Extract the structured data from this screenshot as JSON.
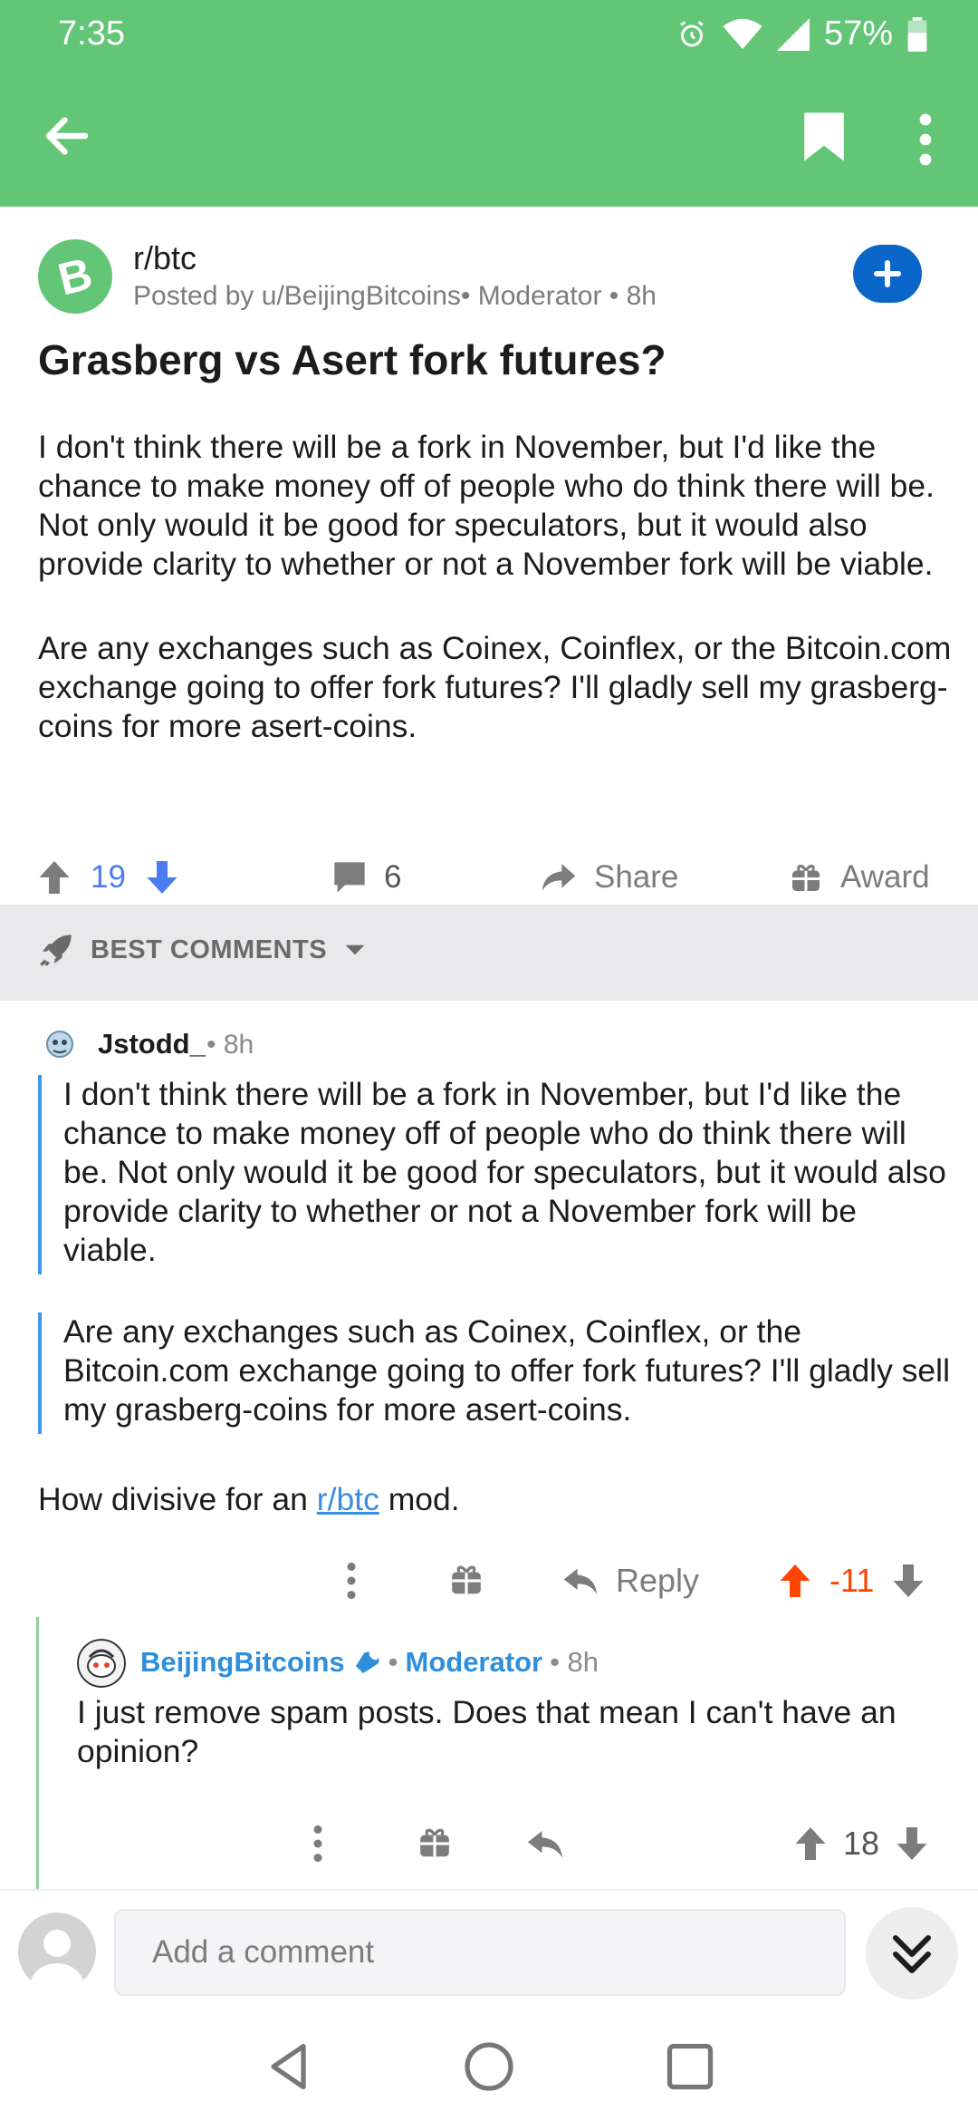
{
  "status_bar": {
    "time": "7:35",
    "battery": "57%"
  },
  "toolbar": {
    "back_icon": "arrow-left-icon",
    "bookmark_icon": "bookmark-icon",
    "more_icon": "more-vertical-icon"
  },
  "post": {
    "subreddit": "r/btc",
    "meta": "Posted by u/BeijingBitcoins• Moderator • 8h",
    "title": "Grasberg vs Asert fork futures?",
    "body": [
      "I don't think there will be a fork in November, but I'd like the chance to make money off of people who do think there will be. Not only would it be good for speculators, but it would also provide clarity to whether or not a November fork will be viable.",
      "Are any exchanges such as Coinex, Coinflex, or the Bitcoin.com exchange going to offer fork futures? I'll gladly sell my grasberg-coins for more asert-coins."
    ],
    "votes": "19",
    "comments": "6",
    "share_label": "Share",
    "award_label": "Award"
  },
  "sort": {
    "label": "BEST COMMENTS"
  },
  "comment": {
    "author": "Jstodd_",
    "time": "• 8h",
    "quote": [
      "I don't think there will be a fork in November, but I'd like the chance to make money off of people who do think there will be. Not only would it be good for speculators, but it would also provide clarity to whether or not a November fork will be viable.",
      "Are any exchanges such as Coinex, Coinflex, or the Bitcoin.com exchange going to offer fork futures? I'll gladly sell my grasberg-coins for more asert-coins."
    ],
    "text_before": "How divisive for an ",
    "link": "r/btc",
    "text_after": " mod.",
    "reply_label": "Reply",
    "score": "-11"
  },
  "reply": {
    "author": "BeijingBitcoins",
    "moderator": "Moderator",
    "time": "• 8h",
    "text": "I just remove spam posts. Does that mean I can't have an opinion?",
    "score": "18"
  },
  "comment_bar": {
    "placeholder": "Add a comment"
  },
  "colors": {
    "header_green": "#63c576",
    "blue_accent": "#0a66c8",
    "upvote_orange": "#ff4500",
    "link_blue": "#3a8ee0"
  }
}
